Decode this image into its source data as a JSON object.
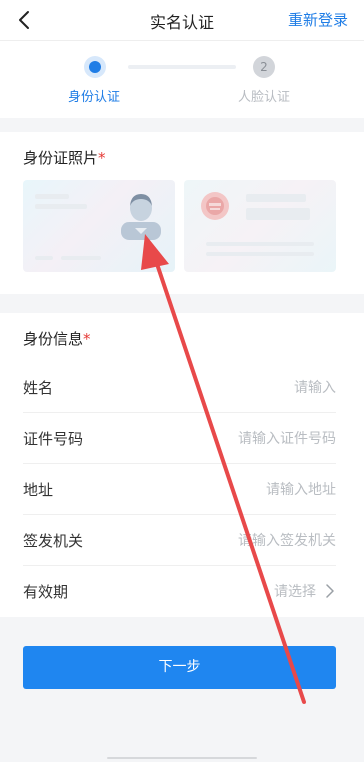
{
  "header": {
    "title": "实名认证",
    "relogin_label": "重新登录"
  },
  "steps": [
    {
      "label": "身份认证",
      "state": "active"
    },
    {
      "label": "人脸认证",
      "number": "2",
      "state": "pending"
    }
  ],
  "photo_section": {
    "title": "身份证照片",
    "required_mark": "*"
  },
  "info_section": {
    "title": "身份信息",
    "required_mark": "*",
    "fields": [
      {
        "label": "姓名",
        "placeholder": "请输入"
      },
      {
        "label": "证件号码",
        "placeholder": "请输入证件号码"
      },
      {
        "label": "地址",
        "placeholder": "请输入地址"
      },
      {
        "label": "签发机关",
        "placeholder": "请输入签发机关"
      },
      {
        "label": "有效期",
        "placeholder": "请选择"
      }
    ]
  },
  "next_button": {
    "label": "下一步"
  },
  "colors": {
    "accent": "#1f7de6",
    "button": "#1f86f0",
    "required": "#e53935",
    "annotation_arrow": "#e8494a"
  }
}
